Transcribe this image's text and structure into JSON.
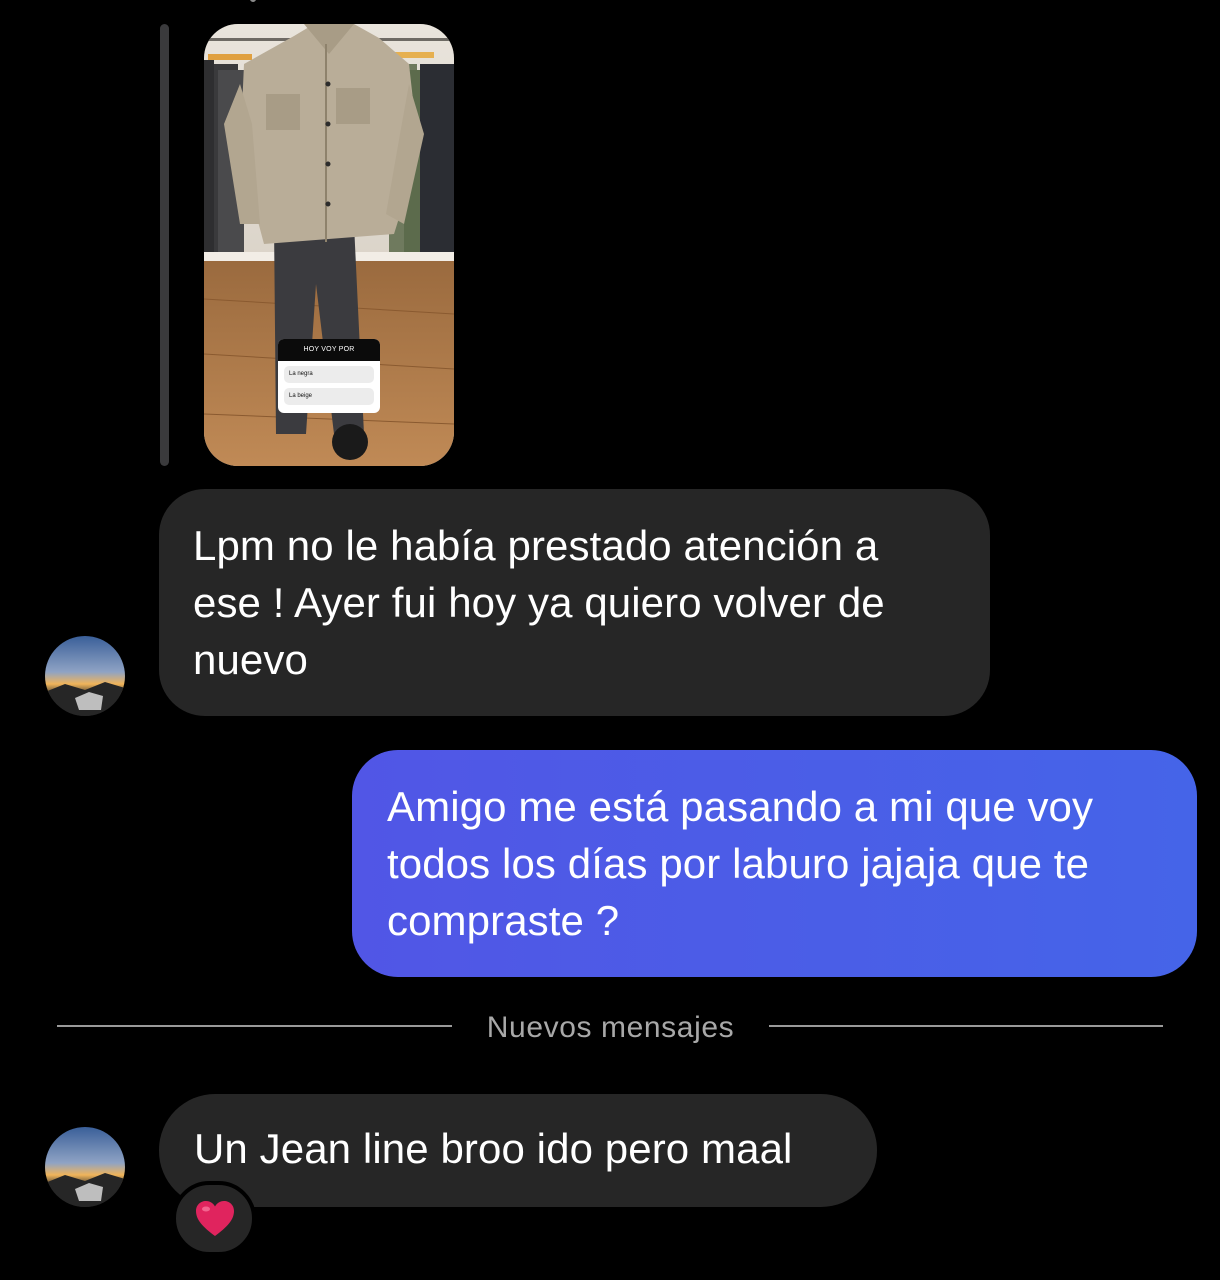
{
  "story_reply": {
    "thumbnail_icon": "story-photo",
    "poll": {
      "title": "HOY VOY POR",
      "options": [
        "La negra",
        "La beige"
      ]
    }
  },
  "messages": [
    {
      "direction": "incoming",
      "text": "Lpm no le había prestado atención a ese ! Ayer fui hoy ya quiero volver de nuevo"
    },
    {
      "direction": "outgoing",
      "text": "Amigo me está pasando a mi que voy todos los días por laburo jajaja que te compraste ?"
    },
    {
      "direction": "incoming",
      "text": "Un Jean line broo ido pero maal",
      "reaction": "❤️"
    }
  ],
  "divider": {
    "label": "Nuevos mensajes"
  },
  "colors": {
    "background": "#000000",
    "incoming_bubble": "#262626",
    "outgoing_bubble": "#4c5de8",
    "divider": "#9a9a9a",
    "heart": "#e0245e"
  }
}
